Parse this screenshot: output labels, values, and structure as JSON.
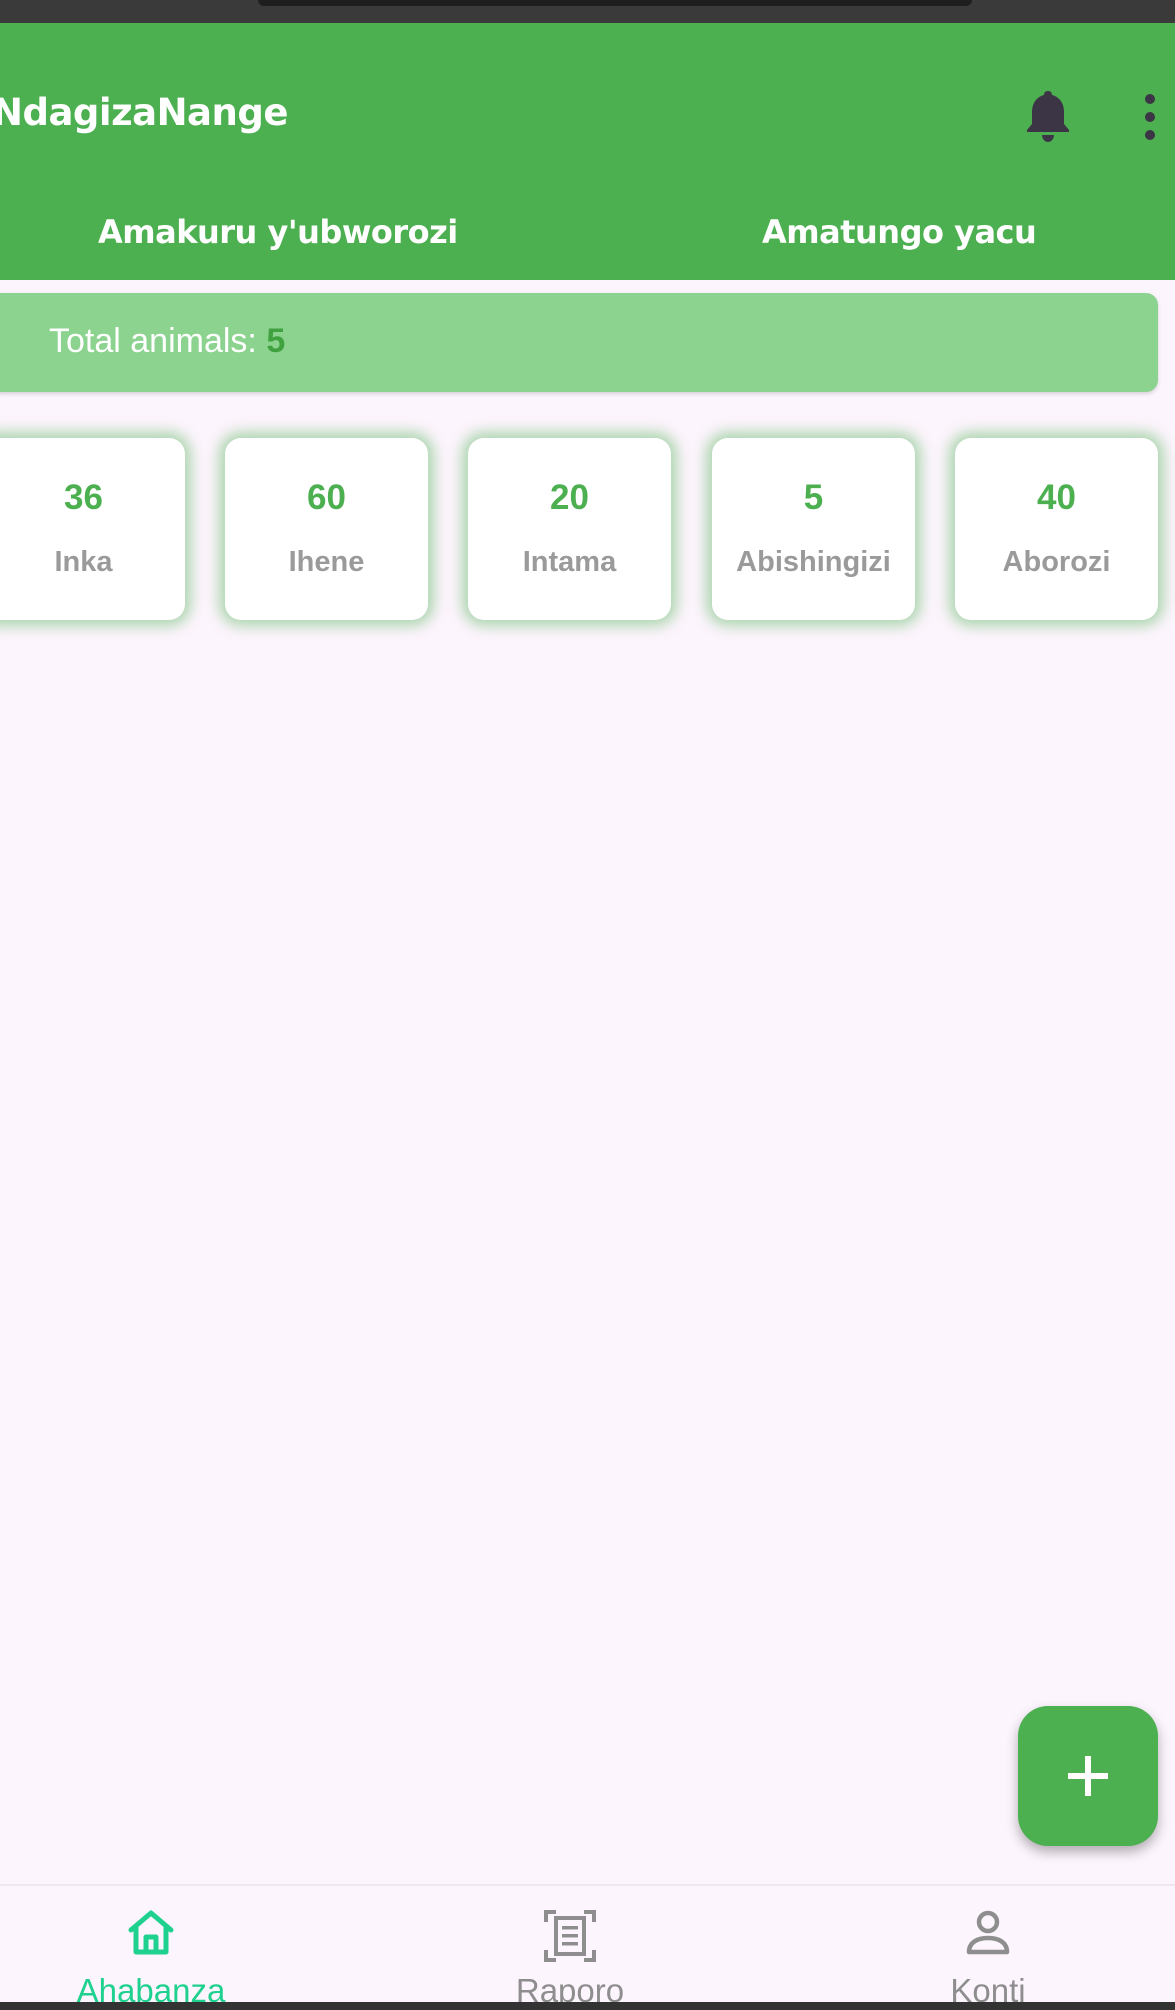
{
  "app": {
    "title": "NdagizaNange"
  },
  "tabs": [
    {
      "label": "Amakuru y'ubworozi",
      "active": true
    },
    {
      "label": "Amatungo yacu",
      "active": false
    }
  ],
  "summary": {
    "label": "Total animals: ",
    "count": "5"
  },
  "animals": [
    {
      "count": "36",
      "label": "Inka"
    },
    {
      "count": "60",
      "label": "Ihene"
    },
    {
      "count": "20",
      "label": "Intama"
    },
    {
      "count": "5",
      "label": "Abishingizi"
    },
    {
      "count": "40",
      "label": "Aborozi"
    }
  ],
  "icons": {
    "notifications": "bell-icon",
    "menu": "more-vert-icon",
    "add": "plus-icon",
    "home": "home-icon",
    "reports": "document-scan-icon",
    "account": "person-icon"
  },
  "bottom_nav": [
    {
      "label": "Ahabanza",
      "active": true
    },
    {
      "label": "Raporo",
      "active": false
    },
    {
      "label": "Konti",
      "active": false
    }
  ],
  "colors": {
    "primary": "#4caf50",
    "tab_indicator": "#f79a1d",
    "summary_bg": "#8cd38f",
    "nav_active": "#1fd18e",
    "nav_inactive": "#8e8e8e",
    "background": "#fdf5fd"
  }
}
